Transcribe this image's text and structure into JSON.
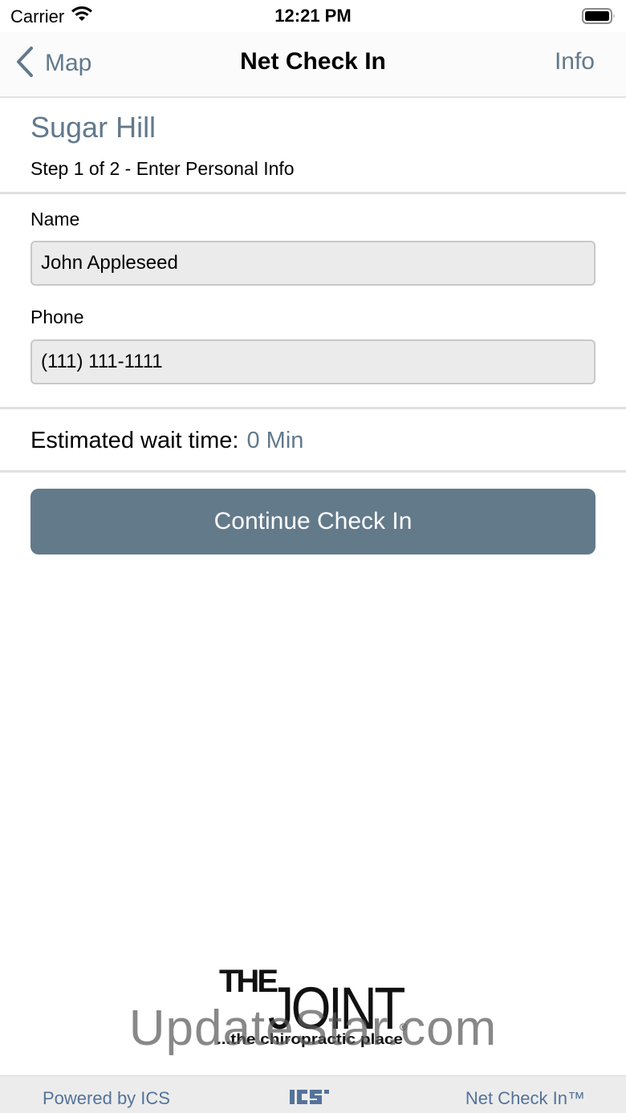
{
  "status_bar": {
    "carrier": "Carrier",
    "time": "12:21 PM"
  },
  "nav": {
    "back_label": "Map",
    "title": "Net Check In",
    "info_label": "Info"
  },
  "location": {
    "name": "Sugar Hill",
    "step": "Step 1 of 2 - Enter Personal Info"
  },
  "form": {
    "name_label": "Name",
    "name_value": "John Appleseed",
    "phone_label": "Phone",
    "phone_value": "(111) 111-1111"
  },
  "wait": {
    "label": "Estimated wait time:",
    "value": "0 Min"
  },
  "continue_button": "Continue Check In",
  "logo": {
    "text_the": "THE",
    "text_joint": "JOINT",
    "tagline": "...the chiropractic place",
    "registered": "®"
  },
  "watermark": "UpdateStar.com",
  "footer": {
    "powered_by": "Powered by ICS",
    "product": "Net Check In™"
  },
  "colors": {
    "accent": "#62798c",
    "button": "#637a8b",
    "footer_text": "#54739a",
    "input_bg": "#ebebeb"
  }
}
